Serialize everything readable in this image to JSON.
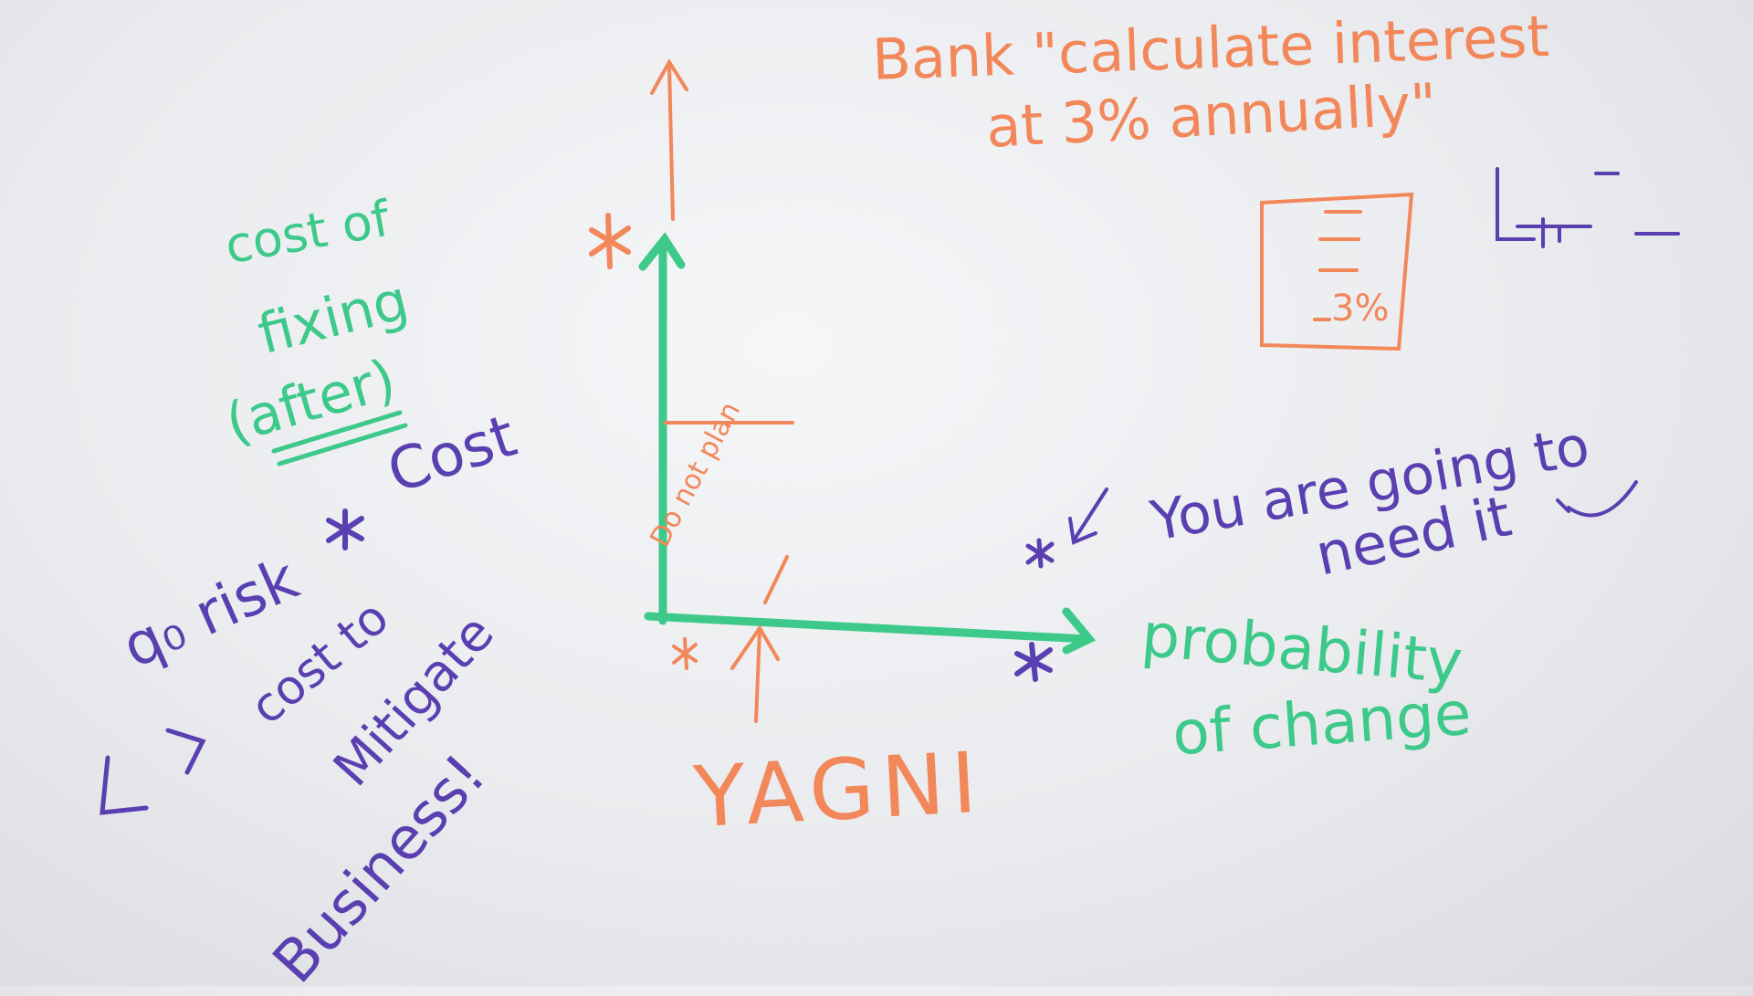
{
  "colors": {
    "orange": "#f2875a",
    "green": "#3dc98a",
    "purple": "#5a3fb0",
    "board": "#eceef1"
  },
  "whiteboard": {
    "bank_line1": "Bank \"calculate interest",
    "bank_line2": "at 3% annually\"",
    "box_value": "3%",
    "yagni": "YAGNI",
    "do_not_plan": "Do not plan",
    "y_axis_label": {
      "line1": "cost of",
      "line2": "fixing",
      "line3": "(after)"
    },
    "x_axis_label": {
      "line1": "probability",
      "line2": "of change"
    },
    "cost_word": "Cost",
    "risk_label": "q₀ risk",
    "cost_to": "cost to",
    "mitigate": "Mitigate",
    "business": "Business!",
    "you_are_going_to": "You are going to",
    "need_it": "need it",
    "smiley": "☺"
  }
}
